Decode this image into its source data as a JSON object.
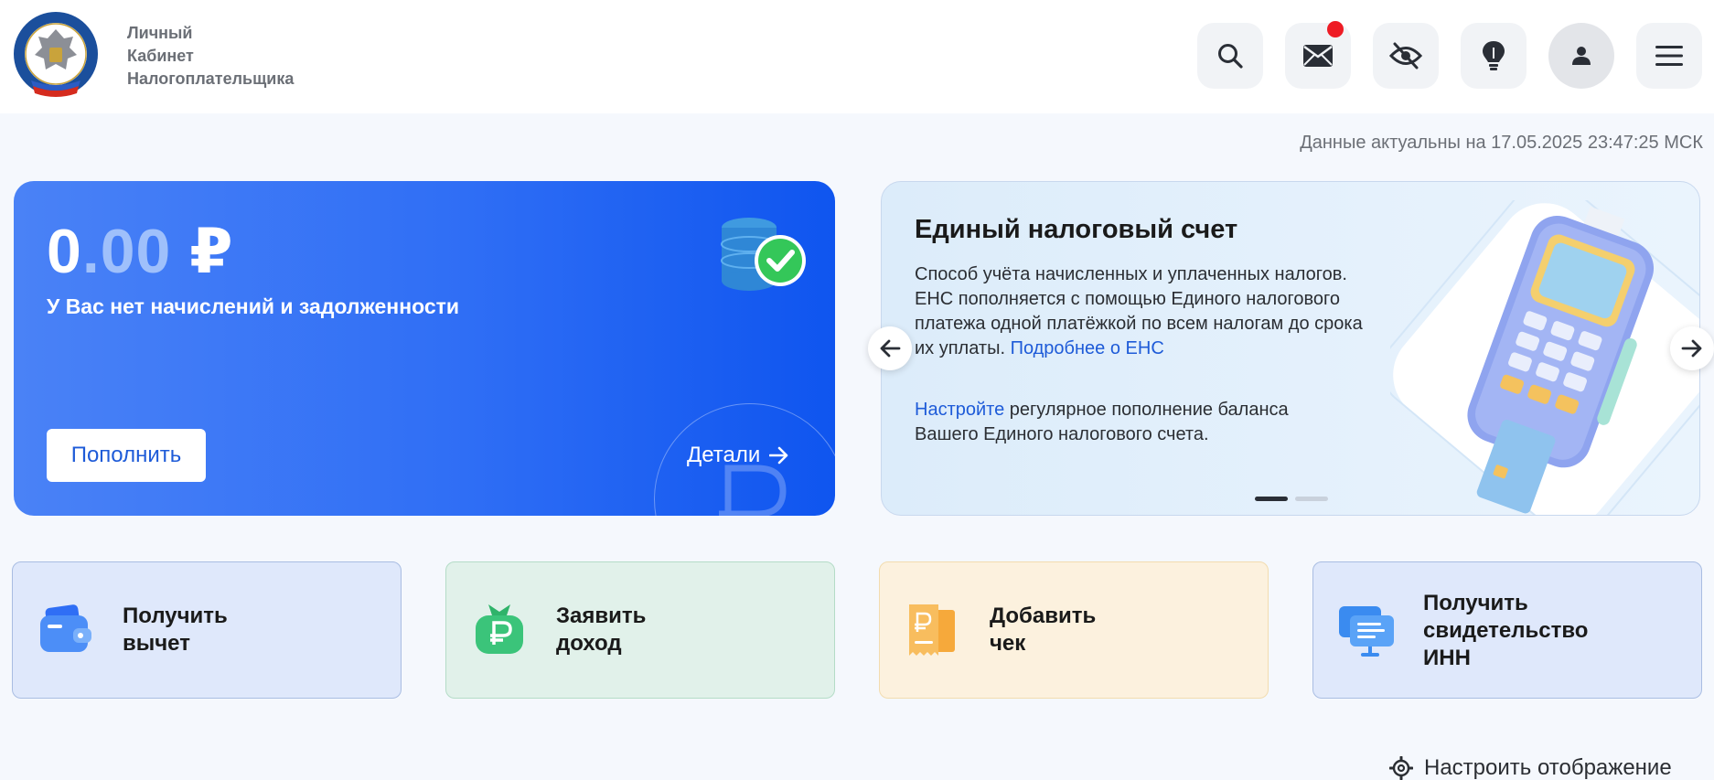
{
  "header": {
    "brand_lines": [
      "Личный",
      "Кабинет",
      "Налогоплательщика"
    ],
    "logo_icon": "fns-emblem-icon",
    "buttons": [
      {
        "name": "search-icon"
      },
      {
        "name": "mail-icon",
        "has_notification": true
      },
      {
        "name": "eye-off-icon"
      },
      {
        "name": "lightbulb-icon"
      },
      {
        "name": "user-icon"
      },
      {
        "name": "menu-icon"
      }
    ]
  },
  "updated_text": "Данные актуальны на 17.05.2025 23:47:25 МСК",
  "balance": {
    "amount_int": "0",
    "amount_frac": ".00",
    "currency": "₽",
    "subtitle": "У Вас нет начислений и задолженности",
    "topup_label": "Пополнить",
    "details_label": "Детали"
  },
  "ens": {
    "title": "Единый налоговый счет",
    "text": "Способ учёта начисленных и уплаченных налогов. ЕНС пополняется с помощью Единого налогового платежа одной платёжкой по всем налогам до срока их уплаты.",
    "more_link": "Подробнее о ЕНС",
    "setup_link": "Настройте",
    "setup_text": "регулярное пополнение баланса Вашего Единого налогового счета.",
    "slides_count": 2,
    "active_slide": 1
  },
  "tiles": [
    {
      "lines": [
        "Получить",
        "вычет"
      ],
      "icon": "wallet-icon",
      "bg": "#dfe8fb",
      "border": "#a9bde2"
    },
    {
      "lines": [
        "Заявить",
        "доход"
      ],
      "icon": "ruble-bag-icon",
      "bg": "#e1f1ea",
      "border": "#b4dcc7"
    },
    {
      "lines": [
        "Добавить",
        "чек"
      ],
      "icon": "receipt-icon",
      "bg": "#fcf1de",
      "border": "#f2dcaf"
    },
    {
      "lines": [
        "Получить",
        "свидетельство",
        "ИНН"
      ],
      "icon": "certificate-monitor-icon",
      "bg": "#dfe8fb",
      "border": "#a9bde2"
    }
  ],
  "settings_label": "Настроить отображение",
  "colors": {
    "primary": "#1e5bd8",
    "notification": "#ee1c25"
  }
}
